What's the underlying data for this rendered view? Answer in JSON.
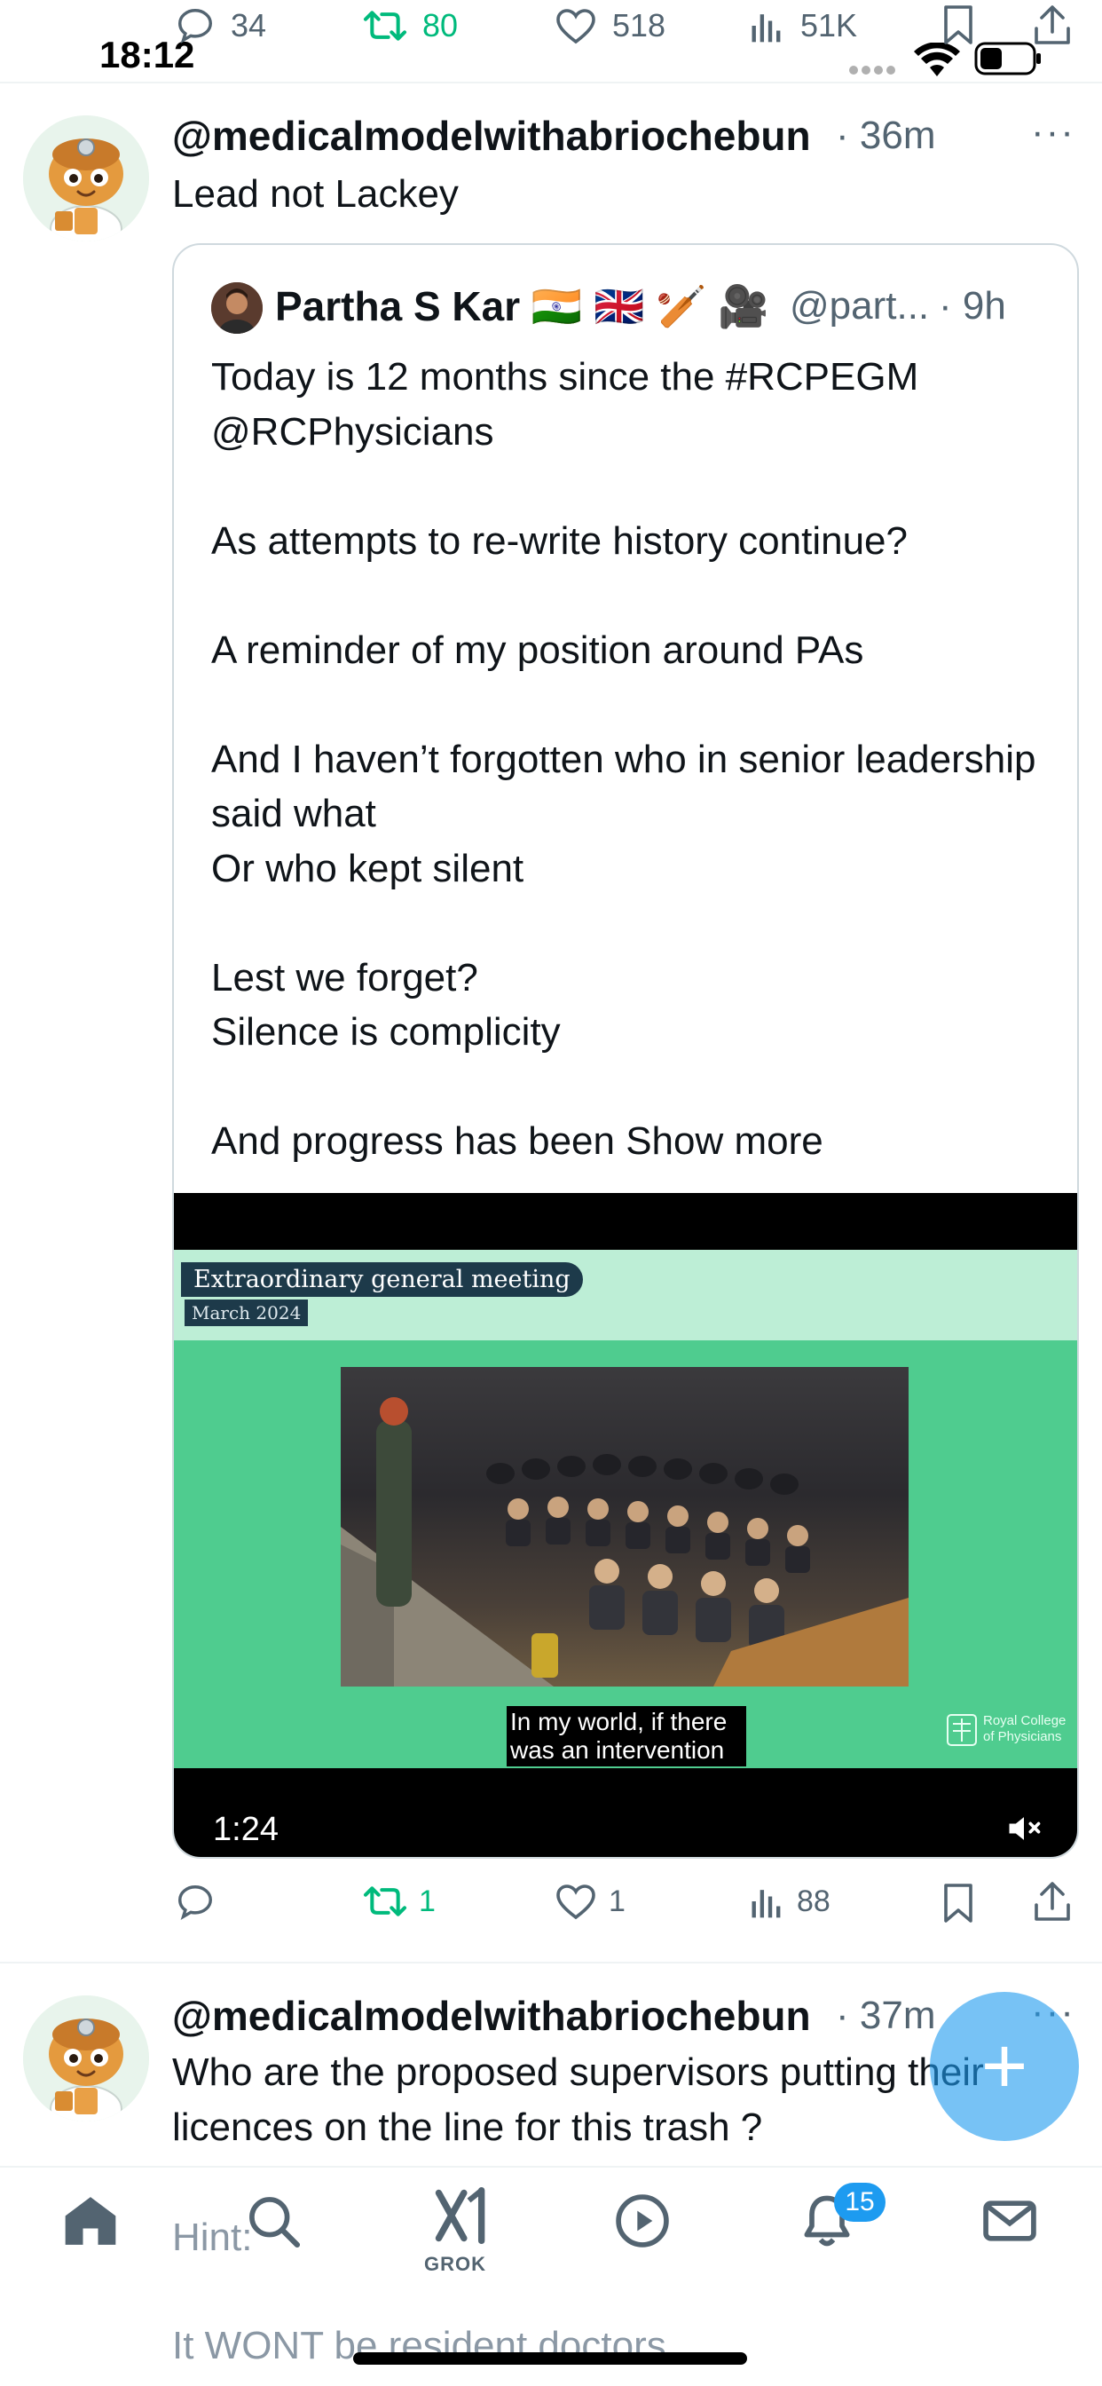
{
  "status_bar": {
    "time": "18:12"
  },
  "prev_tweet_actions": {
    "replies": "34",
    "retweets": "80",
    "likes": "518",
    "views": "51K"
  },
  "tweet1": {
    "handle": "@medicalmodelwithabriochebun",
    "time": "· 36m",
    "text": "Lead not Lackey",
    "more": "···",
    "quote": {
      "name": "Partha S Kar 🇮🇳 🇬🇧 🏏 🎥",
      "handle": "@part...",
      "time": "· 9h",
      "paragraphs": [
        "Today is 12 months since the #RCPEGM @RCPhysicians",
        "As attempts to re-write history continue?",
        "A reminder of my position  around PAs",
        "And I haven’t forgotten who in senior leadership said what\nOr who kept silent",
        "Lest we forget?\nSilence is complicity"
      ],
      "last_paragraph": "And progress has been ",
      "show_more": "Show more",
      "video": {
        "banner_title": "Extraordinary general meeting",
        "banner_date": "March 2024",
        "caption": "In my world, if there was an intervention",
        "logo_text": "Royal College of Physicians",
        "duration": "1:24"
      }
    },
    "actions": {
      "replies": "",
      "retweets": "1",
      "likes": "1",
      "views": "88"
    }
  },
  "tweet2": {
    "handle": "@medicalmodelwithabriochebun",
    "time": "· 37m",
    "text": "Who are the proposed supervisors putting their licences on the line for this trash ?",
    "more": "···"
  },
  "compose_fab": {
    "icon": "plus-icon",
    "label": "+"
  },
  "bottom_nav": {
    "items": [
      "home-icon",
      "search-icon",
      "grok-icon",
      "video-icon",
      "notifications-icon",
      "messages-icon"
    ],
    "grok_label": "GROK",
    "notifications_badge": "15",
    "hint_overlay": "Hint:",
    "peek_text": "It WONT be resident doctors"
  },
  "colors": {
    "accent": "#1d9bf0",
    "retweet": "#00ba7c",
    "muted": "#536471",
    "video_green": "#4fcc8f"
  }
}
